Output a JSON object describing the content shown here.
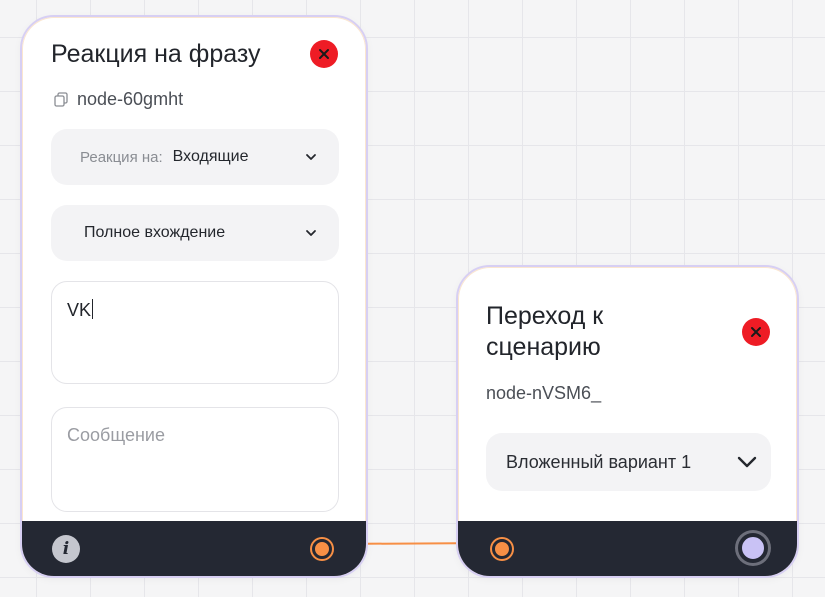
{
  "node_reaction": {
    "title": "Реакция на фразу",
    "id": "node-60gmht",
    "reaction_select": {
      "prefix": "Реакция на:",
      "value": "Входящие"
    },
    "match_select": {
      "value": "Полное вхождение"
    },
    "phrase_input": {
      "value": "VK"
    },
    "message_input": {
      "placeholder": "Сообщение"
    },
    "footer": {
      "info_glyph": "i"
    }
  },
  "node_transition": {
    "title": "Переход к сценарию",
    "id": "node-nVSM6_",
    "variant_select": {
      "value": "Вложенный вариант 1"
    }
  },
  "colors": {
    "close": "#ee1c25",
    "port_orange": "#f78f45",
    "port_lavender": "#c9c2f5",
    "footer": "#242833",
    "connector": "#f78f45"
  },
  "icons": {
    "close": "x-icon",
    "copy": "copy-icon",
    "chevron": "chevron-down-icon",
    "info": "info-icon"
  }
}
